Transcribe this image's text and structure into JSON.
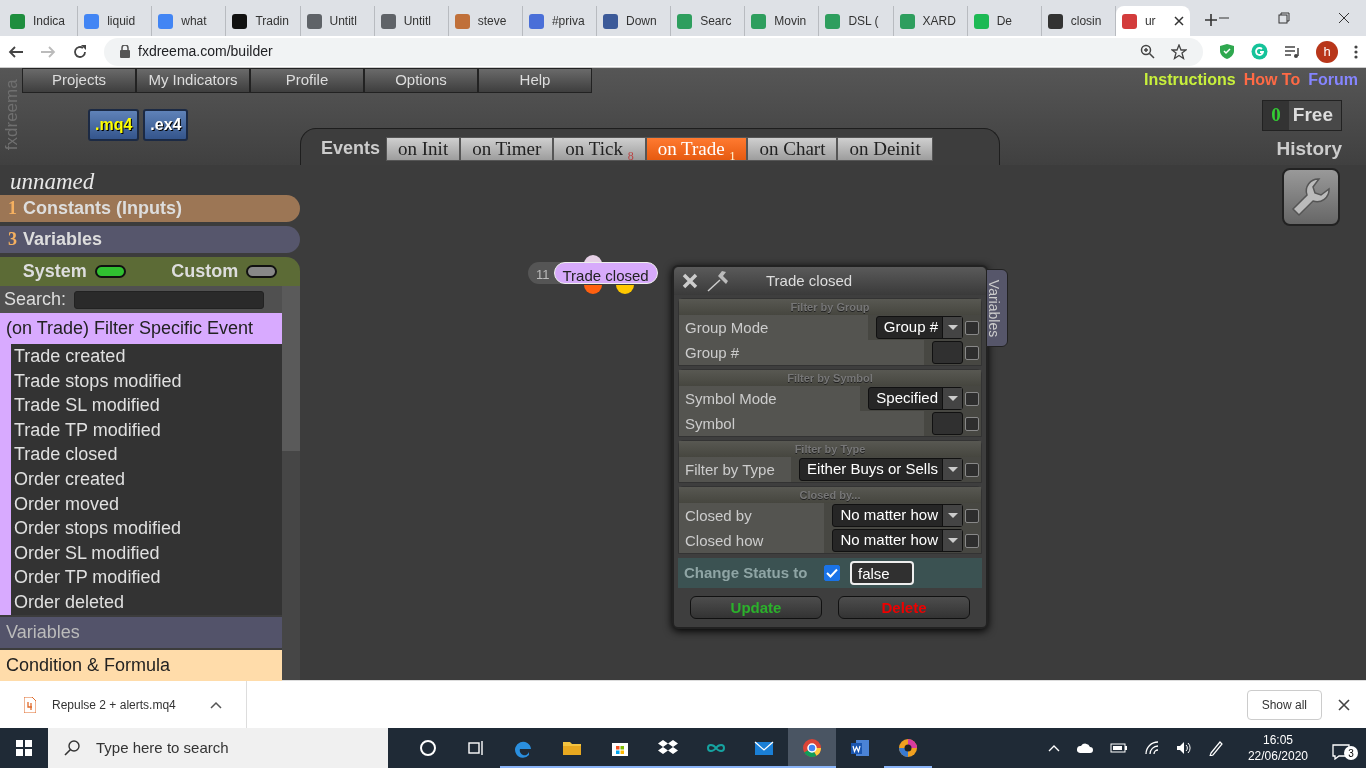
{
  "browser": {
    "tabs": [
      {
        "title": "Indica",
        "color": "#1e8e3e",
        "selected": false
      },
      {
        "title": "liquid",
        "color": "#4285f4",
        "selected": false
      },
      {
        "title": "what",
        "color": "#4285f4",
        "selected": false
      },
      {
        "title": "Tradin",
        "color": "#111111",
        "selected": false
      },
      {
        "title": "Untitl",
        "color": "#5f6368",
        "selected": false
      },
      {
        "title": "Untitl",
        "color": "#5f6368",
        "selected": false
      },
      {
        "title": "steve",
        "color": "#c0703a",
        "selected": false
      },
      {
        "title": "#priva",
        "color": "#4a6fd8",
        "selected": false
      },
      {
        "title": "Down",
        "color": "#3c5a99",
        "selected": false
      },
      {
        "title": "Searc",
        "color": "#2e9e5e",
        "selected": false
      },
      {
        "title": "Movin",
        "color": "#2e9e5e",
        "selected": false
      },
      {
        "title": "DSL (",
        "color": "#2e9e5e",
        "selected": false
      },
      {
        "title": "XARD",
        "color": "#2e9e5e",
        "selected": false
      },
      {
        "title": "De",
        "color": "#1db954",
        "selected": false
      },
      {
        "title": "closin",
        "color": "#333333",
        "selected": false
      },
      {
        "title": "ur",
        "color": "#d33c3c",
        "selected": true
      }
    ],
    "address": "fxdreema.com/builder",
    "avatar": "h"
  },
  "app": {
    "side_label": "fxdreema",
    "menu": [
      "Projects",
      "My Indicators",
      "Profile",
      "Options",
      "Help"
    ],
    "export_buttons": [
      ".mq4",
      ".ex4"
    ],
    "events_label": "Events",
    "event_tabs": [
      {
        "label": "on Init",
        "selected": false
      },
      {
        "label": "on Timer",
        "selected": false
      },
      {
        "label": "on Tick",
        "count": "8",
        "selected": false
      },
      {
        "label": "on Trade",
        "count": "1",
        "selected": true
      },
      {
        "label": "on Chart",
        "selected": false
      },
      {
        "label": "on Deinit",
        "selected": false
      }
    ],
    "links": [
      {
        "label": "Instructions",
        "color": "#c8f03c"
      },
      {
        "label": "How To",
        "color": "#ff6a45"
      },
      {
        "label": "Forum",
        "color": "#8585ff"
      }
    ],
    "credits": {
      "count": "0",
      "label": "Free"
    },
    "history": "History",
    "project_name": "unnamed",
    "sidebar": {
      "sections": [
        {
          "count": "1",
          "label": "Constants (Inputs)",
          "color": "#9c7655"
        },
        {
          "count": "3",
          "label": "Variables",
          "color": "#56566c"
        }
      ],
      "toggles": [
        {
          "label": "System",
          "on": true
        },
        {
          "label": "Custom",
          "on": false
        }
      ],
      "search_label": "Search:",
      "categories": [
        {
          "label": "(on Trade) Filter Specific Event",
          "color": "#d8aaff",
          "expanded": true,
          "items": [
            "Trade created",
            "Trade stops modified",
            "Trade SL modified",
            "Trade TP modified",
            "Trade closed",
            "Order created",
            "Order moved",
            "Order stops modified",
            "Order SL modified",
            "Order TP modified",
            "Order deleted"
          ]
        },
        {
          "label": "Variables",
          "color": "#53536a",
          "expanded": false
        },
        {
          "label": "Condition & Formula",
          "color": "#ffdcaa",
          "expanded": false
        }
      ]
    },
    "node": {
      "number": "11",
      "title": "Trade closed",
      "outputs": [
        {
          "color": "#ff6010"
        },
        {
          "color": "#ffc800"
        }
      ]
    },
    "dialog": {
      "title": "Trade closed",
      "side_tab": "Variables",
      "sections": [
        {
          "title": "Filter by Group",
          "rows": [
            {
              "label": "Group Mode",
              "kind": "select",
              "value": "Group #",
              "checked": false
            },
            {
              "label": "Group #",
              "kind": "input",
              "checked": false
            }
          ]
        },
        {
          "title": "Filter by Symbol",
          "rows": [
            {
              "label": "Symbol Mode",
              "kind": "select",
              "value": "Specified",
              "checked": false
            },
            {
              "label": "Symbol",
              "kind": "input",
              "checked": false
            }
          ]
        },
        {
          "title": "Filter by Type",
          "rows": [
            {
              "label": "Filter by Type",
              "kind": "select",
              "value": "Either Buys or Sells",
              "checked": false
            }
          ]
        },
        {
          "title": "Closed by...",
          "rows": [
            {
              "label": "Closed by",
              "kind": "select",
              "value": "No matter how",
              "checked": false
            },
            {
              "label": "Closed how",
              "kind": "select",
              "value": "No matter how",
              "checked": false
            }
          ]
        }
      ],
      "status": {
        "label": "Change Status to",
        "checked": true,
        "value": "false"
      },
      "buttons": [
        {
          "label": "Update",
          "kind": "update"
        },
        {
          "label": "Delete",
          "kind": "delete"
        }
      ]
    }
  },
  "downloads": {
    "file": "Repulse 2 + alerts.mq4",
    "show_all": "Show all"
  },
  "taskbar": {
    "search_placeholder": "Type here to search",
    "time": "16:05",
    "date": "22/06/2020",
    "notifications": "3"
  }
}
